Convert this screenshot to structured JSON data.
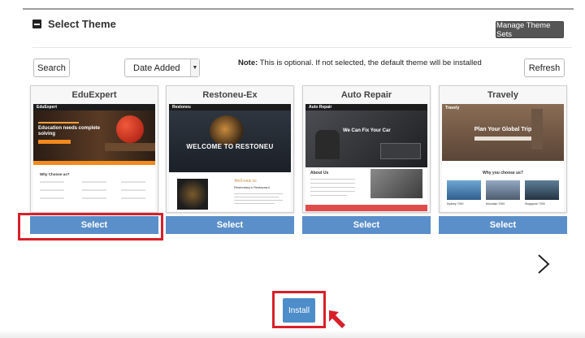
{
  "section": {
    "title": "Select Theme",
    "manage_label": "Manage Theme Sets"
  },
  "toolbar": {
    "search_label": "Search",
    "sort_value": "Date Added",
    "note_label": "Note:",
    "note_text": " This is optional. If not selected, the default theme will be installed",
    "refresh_label": "Refresh"
  },
  "themes": [
    {
      "name": "EduExpert",
      "select_label": "Select",
      "preview": {
        "brand": "EduExpert",
        "headline": "Education needs complete solving",
        "section": "Why Choose us?"
      }
    },
    {
      "name": "Restoneu-Ex",
      "select_label": "Select",
      "preview": {
        "brand": "Restoneu",
        "headline": "WELCOME TO RESTONEU",
        "script": "Welcome to",
        "section": "Restontany's Restaurant"
      }
    },
    {
      "name": "Auto Repair",
      "select_label": "Select",
      "preview": {
        "brand": "Auto Repair",
        "headline": "We Can Fix Your Car",
        "section": "About Us"
      }
    },
    {
      "name": "Travely",
      "select_label": "Select",
      "preview": {
        "brand": "Travely",
        "headline": "Plan Your Global Trip",
        "section": "Why you choose us?",
        "captions": [
          "Sydney 7000",
          "Mountain 7000",
          "Singapore 7000"
        ]
      }
    }
  ],
  "install_label": "Install",
  "colors": {
    "accent": "#5b8fc9",
    "highlight": "#d8202a",
    "dark_button": "#555555"
  },
  "icons": {
    "collapse": "minus-square-icon",
    "next": "chevron-right-icon",
    "pointer": "arrow-up-left-icon"
  }
}
